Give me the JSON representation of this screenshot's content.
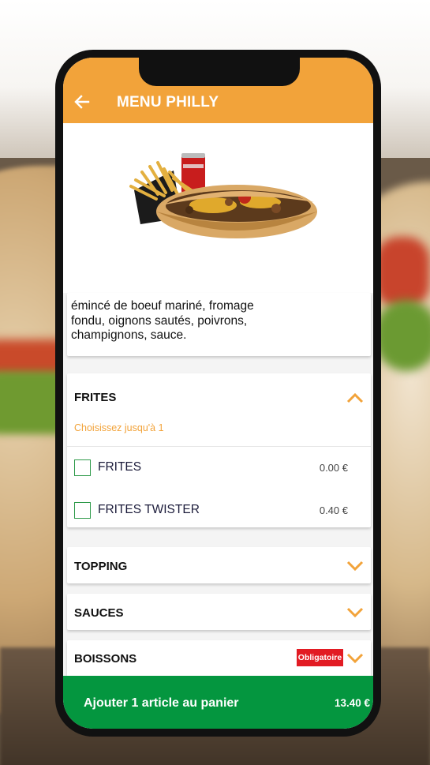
{
  "header": {
    "title": "MENU PHILLY",
    "back_icon": "arrow-left-icon",
    "color": "#f2a33a"
  },
  "product": {
    "image_icon": "sandwich-fries-drink-image",
    "description": "émincé de boeuf mariné, fromage fondu, oignons sautés, poivrons, champignons, sauce."
  },
  "groups": [
    {
      "title": "FRITES",
      "expanded": true,
      "hint": "Choisissez jusqu'à 1",
      "options": [
        {
          "label": "FRITES",
          "price": "0.00 €",
          "checked": false
        },
        {
          "label": "FRITES TWISTER",
          "price": "0.40 €",
          "checked": false
        }
      ]
    },
    {
      "title": "TOPPING",
      "expanded": false
    },
    {
      "title": "SAUCES",
      "expanded": false
    },
    {
      "title": "BOISSONS",
      "expanded": false,
      "badge": "Obligatoire"
    }
  ],
  "cart": {
    "label": "Ajouter 1 article au panier",
    "price": "13.40 €",
    "color": "#04963f"
  }
}
